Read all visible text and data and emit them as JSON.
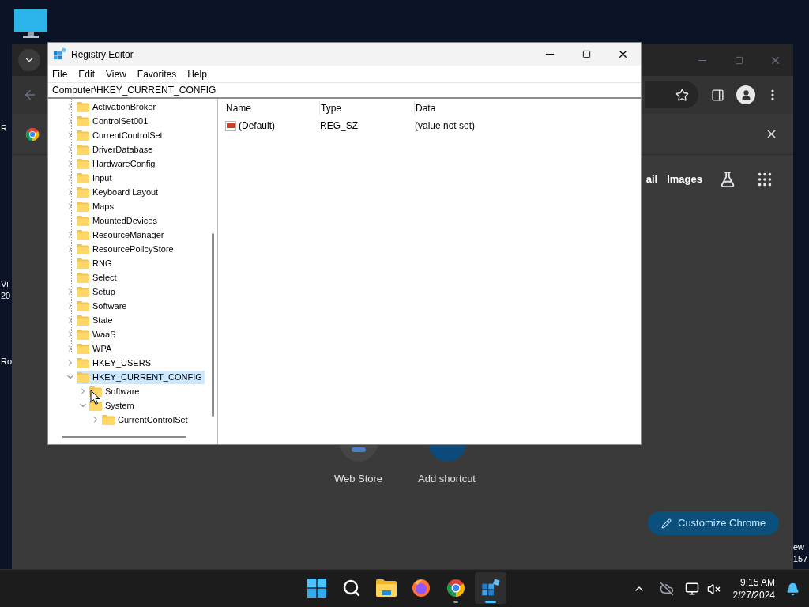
{
  "desktop": {
    "left_labels": [
      [
        "R"
      ],
      [
        "Vi",
        "20"
      ],
      [
        "Ro"
      ]
    ],
    "right_labels": [
      [
        "ew",
        "157"
      ]
    ]
  },
  "browser": {
    "new_tab_links": [
      "ail",
      "Images"
    ],
    "shortcuts": [
      {
        "kind": "web-store",
        "label": "Web Store"
      },
      {
        "kind": "add",
        "label": "Add shortcut"
      }
    ],
    "customize_button": "Customize Chrome"
  },
  "registry_editor": {
    "title": "Registry Editor",
    "menu": [
      "File",
      "Edit",
      "View",
      "Favorites",
      "Help"
    ],
    "address": "Computer\\HKEY_CURRENT_CONFIG",
    "tree": {
      "items": [
        {
          "children": [
            {
              "children": [
                {
                  "label": "ActivationBroker",
                  "expandable": true,
                  "expanded": false,
                  "selected": false
                },
                {
                  "label": "ControlSet001",
                  "expandable": true,
                  "expanded": false,
                  "selected": false
                },
                {
                  "label": "CurrentControlSet",
                  "expandable": true,
                  "expanded": false,
                  "selected": false
                },
                {
                  "label": "DriverDatabase",
                  "expandable": true,
                  "expanded": false,
                  "selected": false
                },
                {
                  "label": "HardwareConfig",
                  "expandable": true,
                  "expanded": false,
                  "selected": false
                },
                {
                  "label": "Input",
                  "expandable": true,
                  "expanded": false,
                  "selected": false
                },
                {
                  "label": "Keyboard Layout",
                  "expandable": true,
                  "expanded": false,
                  "selected": false
                },
                {
                  "label": "Maps",
                  "expandable": true,
                  "expanded": false,
                  "selected": false
                },
                {
                  "label": "MountedDevices",
                  "expandable": false,
                  "selected": false
                },
                {
                  "label": "ResourceManager",
                  "expandable": true,
                  "expanded": false,
                  "selected": false
                },
                {
                  "label": "ResourcePolicyStore",
                  "expandable": true,
                  "expanded": false,
                  "selected": false
                },
                {
                  "label": "RNG",
                  "expandable": false,
                  "selected": false
                },
                {
                  "label": "Select",
                  "expandable": false,
                  "selected": false
                },
                {
                  "label": "Setup",
                  "expandable": true,
                  "expanded": false,
                  "selected": false
                },
                {
                  "label": "Software",
                  "expandable": true,
                  "expanded": false,
                  "selected": false
                },
                {
                  "label": "State",
                  "expandable": true,
                  "expanded": false,
                  "selected": false
                },
                {
                  "label": "WaaS",
                  "expandable": true,
                  "expanded": false,
                  "selected": false
                },
                {
                  "label": "WPA",
                  "expandable": true,
                  "expanded": false,
                  "selected": false
                }
              ]
            }
          ]
        },
        {
          "label": "HKEY_USERS",
          "expandable": true,
          "expanded": false,
          "selected": false
        },
        {
          "label": "HKEY_CURRENT_CONFIG",
          "expandable": true,
          "expanded": true,
          "selected": true,
          "children": [
            {
              "label": "Software",
              "expandable": true,
              "expanded": false,
              "selected": false
            },
            {
              "label": "System",
              "expandable": true,
              "expanded": true,
              "selected": false,
              "children": [
                {
                  "label": "CurrentControlSet",
                  "expandable": true,
                  "expanded": false,
                  "selected": false
                }
              ]
            }
          ]
        }
      ]
    },
    "list": {
      "columns": [
        "Name",
        "Type",
        "Data"
      ],
      "rows": [
        {
          "name": "(Default)",
          "type": "REG_SZ",
          "data": "(value not set)"
        }
      ]
    }
  },
  "taskbar": {
    "apps": [
      {
        "kind": "start",
        "running": false,
        "active": false
      },
      {
        "kind": "search",
        "running": false,
        "active": false
      },
      {
        "kind": "explorer",
        "running": false,
        "active": false
      },
      {
        "kind": "firefox",
        "running": false,
        "active": false
      },
      {
        "kind": "chrome",
        "running": true,
        "active": false
      },
      {
        "kind": "regedit",
        "running": true,
        "active": true
      }
    ],
    "time": "9:15 AM",
    "date": "2/27/2024"
  }
}
